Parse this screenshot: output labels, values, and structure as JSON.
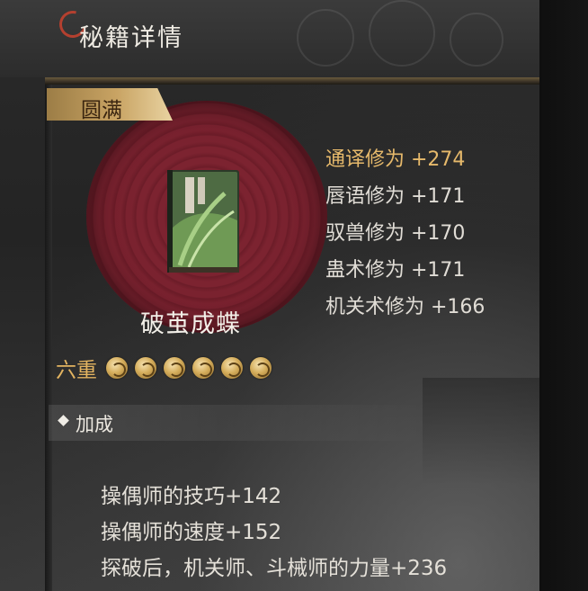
{
  "header": {
    "title": "秘籍详情"
  },
  "book": {
    "status_badge": "圆满",
    "name": "破茧成蝶",
    "tier_label": "六重",
    "tier_count": 6
  },
  "stats": [
    {
      "label": "通译修为 +274",
      "highlight": true
    },
    {
      "label": "唇语修为 +171",
      "highlight": false
    },
    {
      "label": "驭兽修为 +170",
      "highlight": false
    },
    {
      "label": "蛊术修为 +171",
      "highlight": false
    },
    {
      "label": "机关术修为 +166",
      "highlight": false
    }
  ],
  "bonus_section": {
    "title": "加成",
    "items": [
      "操偶师的技巧+142",
      "操偶师的速度+152",
      "探破后，机关师、斗械师的力量+236"
    ]
  },
  "colors": {
    "highlight": "#e6b96b",
    "badge_gold": "#c8a363",
    "rosette": "#7c2330"
  },
  "icons": {
    "tier_coin": "gold-swirl-coin-icon",
    "section_marker": "diamond-icon",
    "logo": "red-swirl-logo-icon"
  }
}
